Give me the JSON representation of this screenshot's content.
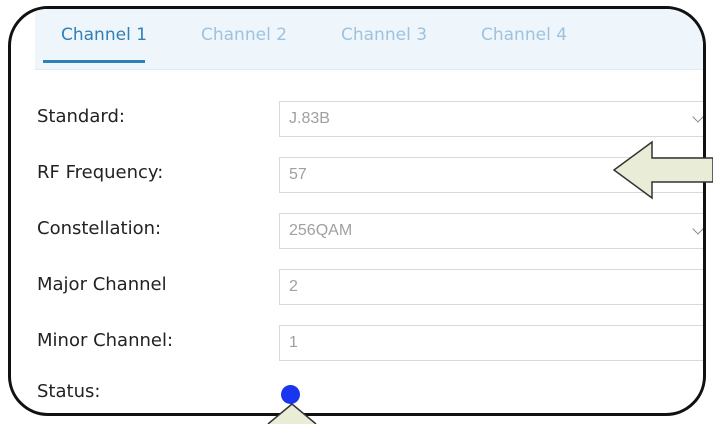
{
  "tabs": [
    {
      "label": "Channel 1",
      "active": true
    },
    {
      "label": "Channel 2",
      "active": false
    },
    {
      "label": "Channel 3",
      "active": false
    },
    {
      "label": "Channel 4",
      "active": false
    }
  ],
  "form": {
    "standard": {
      "label": "Standard:",
      "value": "J.83B"
    },
    "rf_frequency": {
      "label": "RF Frequency:",
      "value": "57"
    },
    "constellation": {
      "label": "Constellation:",
      "value": "256QAM"
    },
    "major_channel": {
      "label": "Major Channel",
      "value": "2"
    },
    "minor_channel": {
      "label": "Minor Channel:",
      "value": "1"
    },
    "status": {
      "label": "Status:",
      "color": "#1a35f0"
    }
  },
  "colors": {
    "tab_active": "#2f7fb8",
    "tab_inactive": "#9dc3df",
    "arrow_fill": "#e9ecd7"
  }
}
